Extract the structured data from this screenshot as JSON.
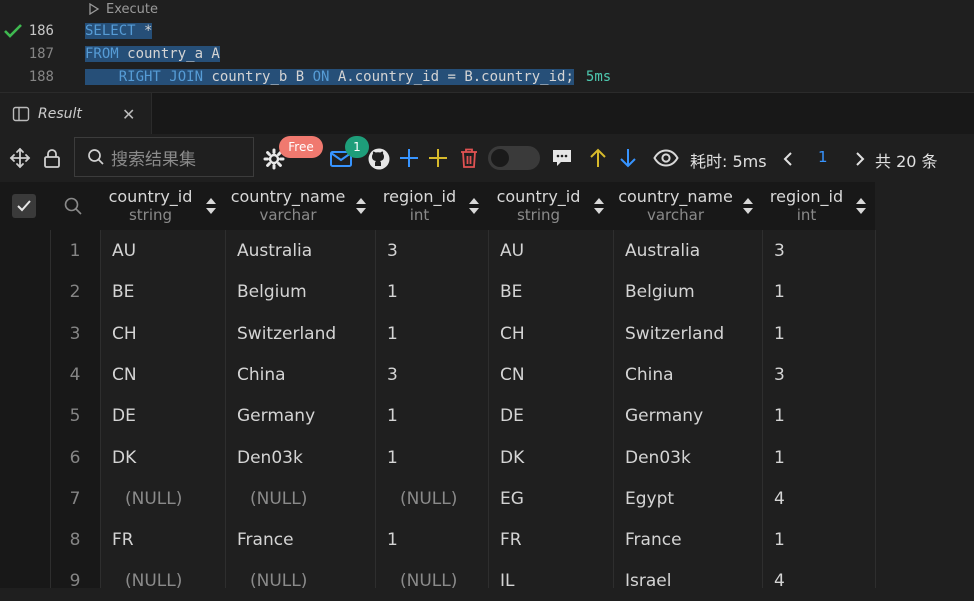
{
  "editor": {
    "codelens": "Execute",
    "lines": [
      {
        "number": "186",
        "tokens": [
          {
            "t": "SELECT",
            "c": "kw"
          },
          {
            "t": " *",
            "c": "id"
          }
        ]
      },
      {
        "number": "187",
        "tokens": [
          {
            "t": "FROM",
            "c": "kw"
          },
          {
            "t": " country_a A",
            "c": "id"
          }
        ]
      },
      {
        "number": "188",
        "tokens": [
          {
            "t": "    ",
            "c": "id"
          },
          {
            "t": "RIGHT JOIN",
            "c": "kw"
          },
          {
            "t": " country_b B ",
            "c": "id"
          },
          {
            "t": "ON",
            "c": "kw"
          },
          {
            "t": " A.country_id = B.country_id;",
            "c": "id"
          }
        ]
      }
    ],
    "exec_time": "5ms"
  },
  "panel": {
    "tab_label": "Result",
    "close_glyph": "✕"
  },
  "toolbar": {
    "search_placeholder": "搜索结果集",
    "free_badge": "Free",
    "notification_count": "1",
    "elapsed": "耗时: 5ms",
    "page": "1",
    "total": "共 20 条",
    "icons": [
      "move-icon",
      "lock-icon",
      "search-icon",
      "gear-icon",
      "mail-icon",
      "github-icon",
      "add-blue-icon",
      "add-yellow-icon",
      "delete-icon",
      "toggle",
      "comment-icon",
      "arrow-up-icon",
      "arrow-down-icon",
      "eye-icon",
      "prev-page-icon",
      "next-page-icon"
    ]
  },
  "columns": [
    {
      "name": "country_id",
      "type": "string"
    },
    {
      "name": "country_name",
      "type": "varchar"
    },
    {
      "name": "region_id",
      "type": "int"
    },
    {
      "name": "country_id",
      "type": "string"
    },
    {
      "name": "country_name",
      "type": "varchar"
    },
    {
      "name": "region_id",
      "type": "int"
    }
  ],
  "rows": [
    {
      "n": "1",
      "cells": [
        "AU",
        "Australia",
        "3",
        "AU",
        "Australia",
        "3"
      ]
    },
    {
      "n": "2",
      "cells": [
        "BE",
        "Belgium",
        "1",
        "BE",
        "Belgium",
        "1"
      ]
    },
    {
      "n": "3",
      "cells": [
        "CH",
        "Switzerland",
        "1",
        "CH",
        "Switzerland",
        "1"
      ]
    },
    {
      "n": "4",
      "cells": [
        "CN",
        "China",
        "3",
        "CN",
        "China",
        "3"
      ]
    },
    {
      "n": "5",
      "cells": [
        "DE",
        "Germany",
        "1",
        "DE",
        "Germany",
        "1"
      ]
    },
    {
      "n": "6",
      "cells": [
        "DK",
        "Den03k",
        "1",
        "DK",
        "Den03k",
        "1"
      ]
    },
    {
      "n": "7",
      "cells": [
        "(NULL)",
        "(NULL)",
        "(NULL)",
        "EG",
        "Egypt",
        "4"
      ]
    },
    {
      "n": "8",
      "cells": [
        "FR",
        "France",
        "1",
        "FR",
        "France",
        "1"
      ]
    },
    {
      "n": "9",
      "cells": [
        "(NULL)",
        "(NULL)",
        "(NULL)",
        "IL",
        "Israel",
        "4"
      ]
    }
  ],
  "colors": {
    "keyword": "#569cd6",
    "accent": "#3794ff",
    "success": "#4ec9b0",
    "free_badge": "#f0796f",
    "count_badge": "#1e9e7a"
  }
}
